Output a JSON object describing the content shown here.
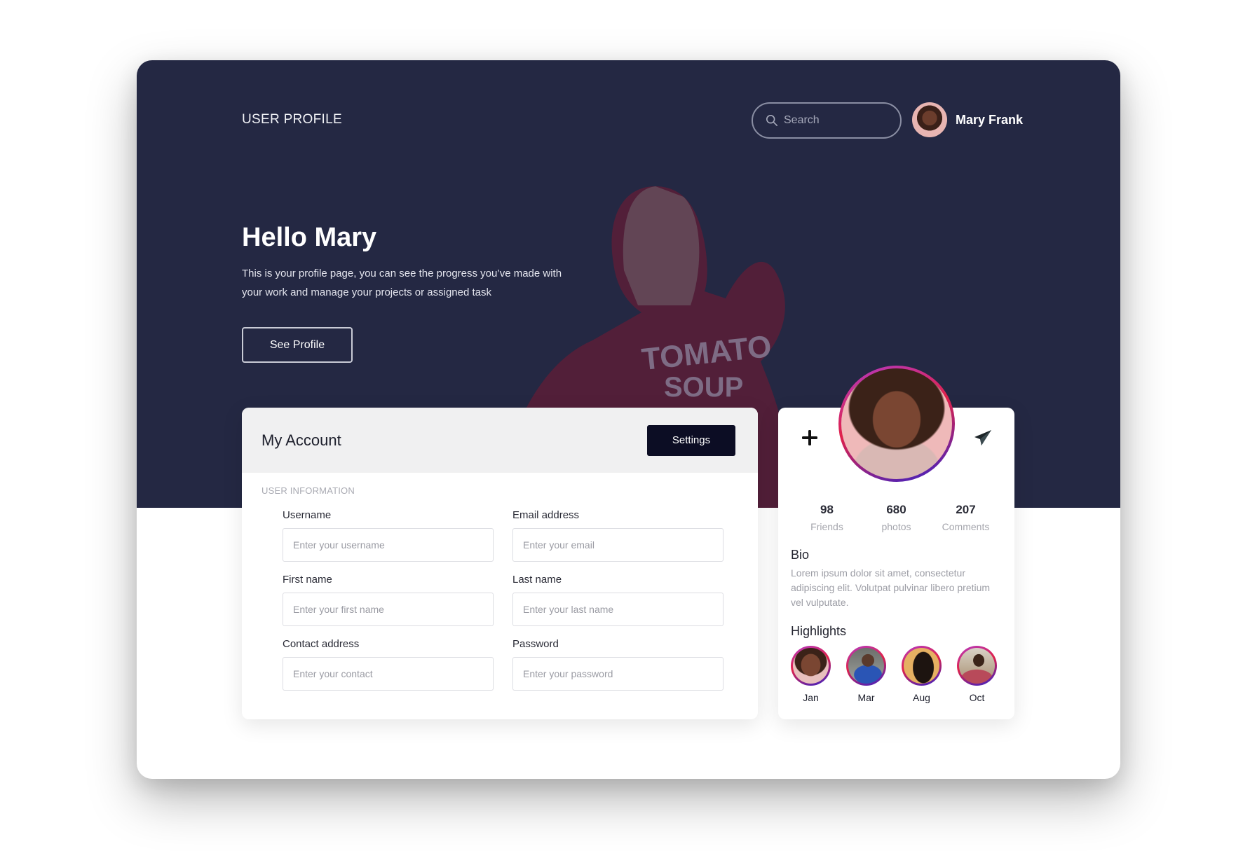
{
  "header": {
    "title": "USER PROFILE",
    "search_placeholder": "Search",
    "user_name": "Mary Frank"
  },
  "hero": {
    "greeting": "Hello Mary",
    "description": "This is your profile page, you can see the progress you’ve made with your work and manage your projects or assigned task",
    "button_label": "See Profile",
    "background_shirt_text_1": "TOMATO",
    "background_shirt_text_2": "SOUP"
  },
  "account": {
    "title": "My Account",
    "settings_label": "Settings",
    "section_label": "USER INFORMATION",
    "fields": [
      {
        "label": "Username",
        "placeholder": "Enter your username",
        "value": ""
      },
      {
        "label": "Email address",
        "placeholder": "Enter your email",
        "value": ""
      },
      {
        "label": "First name",
        "placeholder": "Enter your first name",
        "value": ""
      },
      {
        "label": "Last name",
        "placeholder": "Enter your last name",
        "value": ""
      },
      {
        "label": "Contact address",
        "placeholder": "Enter your contact",
        "value": ""
      },
      {
        "label": "Password",
        "placeholder": "Enter your password",
        "value": ""
      }
    ]
  },
  "profile": {
    "icons": {
      "left": "plus-icon",
      "right": "paper-plane-icon"
    },
    "stats": [
      {
        "value": "98",
        "label": "Friends"
      },
      {
        "value": "680",
        "label": "photos"
      },
      {
        "value": "207",
        "label": "Comments"
      }
    ],
    "bio_title": "Bio",
    "bio_text": "Lorem ipsum dolor sit amet, consectetur adipiscing elit. Volutpat pulvinar libero pretium vel vulputate.",
    "highlights_title": "Highlights",
    "highlights": [
      {
        "label": "Jan"
      },
      {
        "label": "Mar"
      },
      {
        "label": "Aug"
      },
      {
        "label": "Oct"
      }
    ]
  },
  "colors": {
    "hero_bg": "#242843",
    "button_dark": "#0c0d24",
    "ring_gradient": [
      "#b23bc7",
      "#e0214a",
      "#3523c9"
    ]
  }
}
